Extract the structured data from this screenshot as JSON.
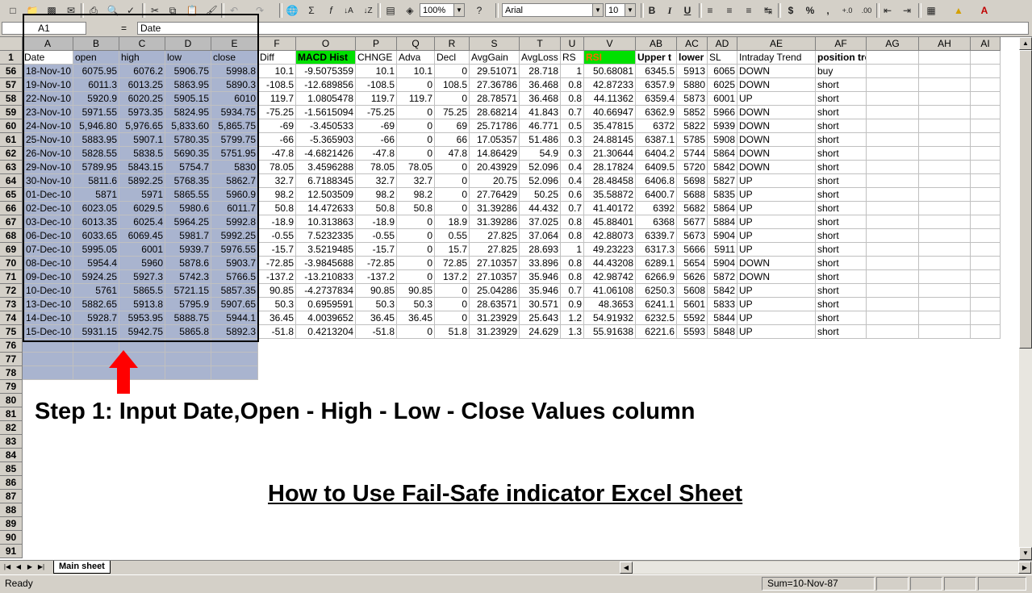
{
  "toolbar": {
    "zoom": "100%",
    "font_name": "Arial",
    "font_size": "10",
    "bold_label": "B",
    "italic_label": "I",
    "underline_label": "U",
    "currency_label": "$",
    "percent_label": "%",
    "comma_label": ","
  },
  "formula_bar": {
    "name_box": "A1",
    "eq": "=",
    "content": "Date"
  },
  "columns": [
    "A",
    "B",
    "C",
    "D",
    "E",
    "F",
    "O",
    "P",
    "Q",
    "R",
    "S",
    "T",
    "U",
    "V",
    "AB",
    "AC",
    "AD",
    "AE",
    "AF",
    "AG",
    "AH",
    "AI"
  ],
  "header_row": {
    "number": "1",
    "cells": [
      "Date",
      "open",
      "high",
      "low",
      "close",
      "Diff",
      "MACD Hist",
      "CHNGE",
      "Adva",
      "Decl",
      "AvgGain",
      "AvgLoss",
      "RS",
      "RSI",
      "Upper t",
      "lower",
      "SL",
      "Intraday Trend",
      "position trend",
      "",
      "",
      ""
    ]
  },
  "rows": [
    {
      "n": "56",
      "cells": [
        "18-Nov-10",
        "6075.95",
        "6076.2",
        "5906.75",
        "5998.8",
        "10.1",
        "-9.5075359",
        "10.1",
        "10.1",
        "0",
        "29.51071",
        "28.718",
        "1",
        "50.68081",
        "6345.5",
        "5913",
        "6065",
        "DOWN",
        "buy",
        "",
        "",
        ""
      ]
    },
    {
      "n": "57",
      "cells": [
        "19-Nov-10",
        "6011.3",
        "6013.25",
        "5863.95",
        "5890.3",
        "-108.5",
        "-12.689856",
        "-108.5",
        "0",
        "108.5",
        "27.36786",
        "36.468",
        "0.8",
        "42.87233",
        "6357.9",
        "5880",
        "6025",
        "DOWN",
        "short",
        "",
        "",
        ""
      ]
    },
    {
      "n": "58",
      "cells": [
        "22-Nov-10",
        "5920.9",
        "6020.25",
        "5905.15",
        "6010",
        "119.7",
        "1.0805478",
        "119.7",
        "119.7",
        "0",
        "28.78571",
        "36.468",
        "0.8",
        "44.11362",
        "6359.4",
        "5873",
        "6001",
        "UP",
        "short",
        "",
        "",
        ""
      ]
    },
    {
      "n": "59",
      "cells": [
        "23-Nov-10",
        "5971.55",
        "5973.35",
        "5824.95",
        "5934.75",
        "-75.25",
        "-1.5615094",
        "-75.25",
        "0",
        "75.25",
        "28.68214",
        "41.843",
        "0.7",
        "40.66947",
        "6362.9",
        "5852",
        "5966",
        "DOWN",
        "short",
        "",
        "",
        ""
      ]
    },
    {
      "n": "60",
      "cells": [
        "24-Nov-10",
        "5,946.80",
        "5,976.65",
        "5,833.60",
        "5,865.75",
        "-69",
        "-3.450533",
        "-69",
        "0",
        "69",
        "25.71786",
        "46.771",
        "0.5",
        "35.47815",
        "6372",
        "5822",
        "5939",
        "DOWN",
        "short",
        "",
        "",
        ""
      ]
    },
    {
      "n": "61",
      "cells": [
        "25-Nov-10",
        "5883.95",
        "5907.1",
        "5780.35",
        "5799.75",
        "-66",
        "-5.365903",
        "-66",
        "0",
        "66",
        "17.05357",
        "51.486",
        "0.3",
        "24.88145",
        "6387.1",
        "5785",
        "5908",
        "DOWN",
        "short",
        "",
        "",
        ""
      ]
    },
    {
      "n": "62",
      "cells": [
        "26-Nov-10",
        "5828.55",
        "5838.5",
        "5690.35",
        "5751.95",
        "-47.8",
        "-4.6821426",
        "-47.8",
        "0",
        "47.8",
        "14.86429",
        "54.9",
        "0.3",
        "21.30644",
        "6404.2",
        "5744",
        "5864",
        "DOWN",
        "short",
        "",
        "",
        ""
      ]
    },
    {
      "n": "63",
      "cells": [
        "29-Nov-10",
        "5789.95",
        "5843.15",
        "5754.7",
        "5830",
        "78.05",
        "3.4596288",
        "78.05",
        "78.05",
        "0",
        "20.43929",
        "52.096",
        "0.4",
        "28.17824",
        "6409.5",
        "5720",
        "5842",
        "DOWN",
        "short",
        "",
        "",
        ""
      ]
    },
    {
      "n": "64",
      "cells": [
        "30-Nov-10",
        "5811.6",
        "5892.25",
        "5768.35",
        "5862.7",
        "32.7",
        "6.7188345",
        "32.7",
        "32.7",
        "0",
        "20.75",
        "52.096",
        "0.4",
        "28.48458",
        "6406.8",
        "5698",
        "5827",
        "UP",
        "short",
        "",
        "",
        ""
      ]
    },
    {
      "n": "65",
      "cells": [
        "01-Dec-10",
        "5871",
        "5971",
        "5865.55",
        "5960.9",
        "98.2",
        "12.503509",
        "98.2",
        "98.2",
        "0",
        "27.76429",
        "50.25",
        "0.6",
        "35.58872",
        "6400.7",
        "5688",
        "5835",
        "UP",
        "short",
        "",
        "",
        ""
      ]
    },
    {
      "n": "66",
      "cells": [
        "02-Dec-10",
        "6023.05",
        "6029.5",
        "5980.6",
        "6011.7",
        "50.8",
        "14.472633",
        "50.8",
        "50.8",
        "0",
        "31.39286",
        "44.432",
        "0.7",
        "41.40172",
        "6392",
        "5682",
        "5864",
        "UP",
        "short",
        "",
        "",
        ""
      ]
    },
    {
      "n": "67",
      "cells": [
        "03-Dec-10",
        "6013.35",
        "6025.4",
        "5964.25",
        "5992.8",
        "-18.9",
        "10.313863",
        "-18.9",
        "0",
        "18.9",
        "31.39286",
        "37.025",
        "0.8",
        "45.88401",
        "6368",
        "5677",
        "5884",
        "UP",
        "short",
        "",
        "",
        ""
      ]
    },
    {
      "n": "68",
      "cells": [
        "06-Dec-10",
        "6033.65",
        "6069.45",
        "5981.7",
        "5992.25",
        "-0.55",
        "7.5232335",
        "-0.55",
        "0",
        "0.55",
        "27.825",
        "37.064",
        "0.8",
        "42.88073",
        "6339.7",
        "5673",
        "5904",
        "UP",
        "short",
        "",
        "",
        ""
      ]
    },
    {
      "n": "69",
      "cells": [
        "07-Dec-10",
        "5995.05",
        "6001",
        "5939.7",
        "5976.55",
        "-15.7",
        "3.5219485",
        "-15.7",
        "0",
        "15.7",
        "27.825",
        "28.693",
        "1",
        "49.23223",
        "6317.3",
        "5666",
        "5911",
        "UP",
        "short",
        "",
        "",
        ""
      ]
    },
    {
      "n": "70",
      "cells": [
        "08-Dec-10",
        "5954.4",
        "5960",
        "5878.6",
        "5903.7",
        "-72.85",
        "-3.9845688",
        "-72.85",
        "0",
        "72.85",
        "27.10357",
        "33.896",
        "0.8",
        "44.43208",
        "6289.1",
        "5654",
        "5904",
        "DOWN",
        "short",
        "",
        "",
        ""
      ]
    },
    {
      "n": "71",
      "cells": [
        "09-Dec-10",
        "5924.25",
        "5927.3",
        "5742.3",
        "5766.5",
        "-137.2",
        "-13.210833",
        "-137.2",
        "0",
        "137.2",
        "27.10357",
        "35.946",
        "0.8",
        "42.98742",
        "6266.9",
        "5626",
        "5872",
        "DOWN",
        "short",
        "",
        "",
        ""
      ]
    },
    {
      "n": "72",
      "cells": [
        "10-Dec-10",
        "5761",
        "5865.5",
        "5721.15",
        "5857.35",
        "90.85",
        "-4.2737834",
        "90.85",
        "90.85",
        "0",
        "25.04286",
        "35.946",
        "0.7",
        "41.06108",
        "6250.3",
        "5608",
        "5842",
        "UP",
        "short",
        "",
        "",
        ""
      ]
    },
    {
      "n": "73",
      "cells": [
        "13-Dec-10",
        "5882.65",
        "5913.8",
        "5795.9",
        "5907.65",
        "50.3",
        "0.6959591",
        "50.3",
        "50.3",
        "0",
        "28.63571",
        "30.571",
        "0.9",
        "48.3653",
        "6241.1",
        "5601",
        "5833",
        "UP",
        "short",
        "",
        "",
        ""
      ]
    },
    {
      "n": "74",
      "cells": [
        "14-Dec-10",
        "5928.7",
        "5953.95",
        "5888.75",
        "5944.1",
        "36.45",
        "4.0039652",
        "36.45",
        "36.45",
        "0",
        "31.23929",
        "25.643",
        "1.2",
        "54.91932",
        "6232.5",
        "5592",
        "5844",
        "UP",
        "short",
        "",
        "",
        ""
      ]
    },
    {
      "n": "75",
      "cells": [
        "15-Dec-10",
        "5931.15",
        "5942.75",
        "5865.8",
        "5892.3",
        "-51.8",
        "0.4213204",
        "-51.8",
        "0",
        "51.8",
        "31.23929",
        "24.629",
        "1.3",
        "55.91638",
        "6221.6",
        "5593",
        "5848",
        "UP",
        "short",
        "",
        "",
        ""
      ]
    }
  ],
  "empty_rows": [
    "76",
    "77",
    "78",
    "79",
    "80",
    "81",
    "82",
    "83",
    "84",
    "85",
    "86",
    "87",
    "88",
    "89",
    "90",
    "91"
  ],
  "annotations": {
    "step1": "Step 1: Input Date,Open - High - Low - Close Values column",
    "howto": "How to Use Fail-Safe indicator Excel Sheet"
  },
  "sheet_tab": "Main sheet",
  "status": {
    "ready": "Ready",
    "sum": "Sum=10-Nov-87"
  },
  "colors": {
    "selection": "#a9b4cf",
    "macd_header_bg": "#00e000",
    "rsi_header_bg": "#00e000",
    "rsi_header_text": "#ff6600",
    "arrow": "#ff0000"
  }
}
